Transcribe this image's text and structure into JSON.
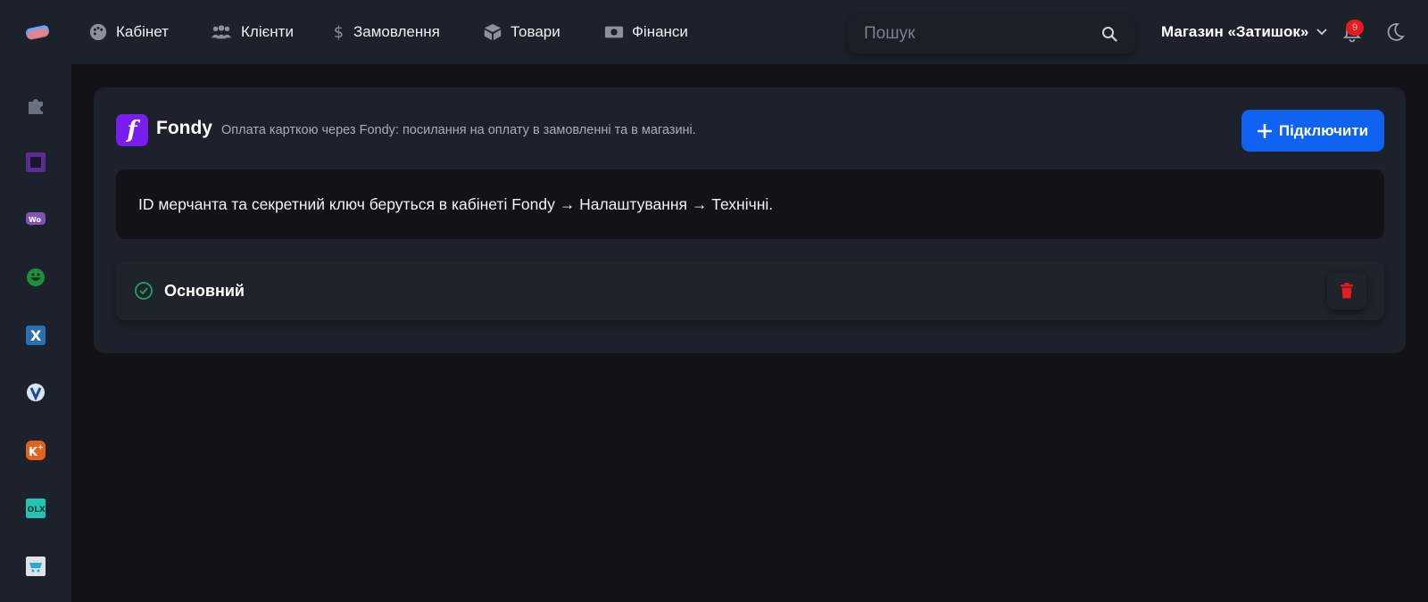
{
  "topnav": {
    "items": [
      {
        "label": "Кабінет",
        "icon": "palette-icon"
      },
      {
        "label": "Клієнти",
        "icon": "users-icon"
      },
      {
        "label": "Замовлення",
        "icon": "dollar-icon"
      },
      {
        "label": "Товари",
        "icon": "box-icon"
      },
      {
        "label": "Фінанси",
        "icon": "money-icon"
      }
    ],
    "search_placeholder": "Пошук",
    "store_name": "Магазин «Затишок»",
    "notifications_count": "9"
  },
  "sidebar": {
    "items": [
      {
        "icon": "puzzle-icon"
      },
      {
        "icon": "square-app-icon"
      },
      {
        "icon": "woocommerce-icon"
      },
      {
        "icon": "green-face-icon"
      },
      {
        "icon": "x-app-icon"
      },
      {
        "icon": "shield-v-icon"
      },
      {
        "icon": "k-plus-icon"
      },
      {
        "icon": "olx-icon"
      },
      {
        "icon": "opencart-icon"
      }
    ]
  },
  "integration": {
    "logo_letter": "f",
    "name": "Fondy",
    "description": "Оплата карткою через Fondy: посилання на оплату в замовленні та в магазині.",
    "connect_label": "Підключити",
    "info": "ID мерчанта та секретний ключ беруться в кабінеті Fondy → Налаштування → Технічні.",
    "account_name": "Основний"
  },
  "colors": {
    "accent": "#1062f0",
    "brand": "#7a1ef0",
    "success": "#22a06b",
    "danger": "#e11d1d"
  }
}
